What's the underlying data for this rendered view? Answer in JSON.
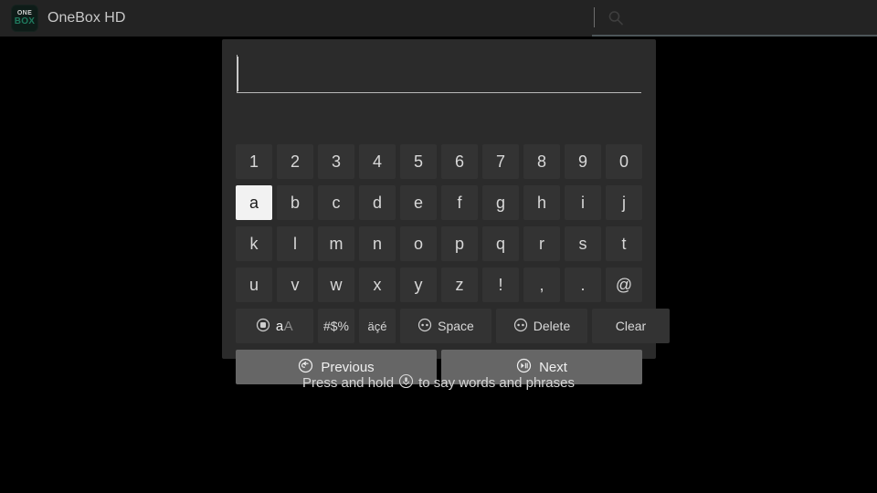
{
  "app": {
    "title": "OneBox HD",
    "logo_line1": "ONE",
    "logo_line2": "BOX"
  },
  "search": {
    "value": "",
    "placeholder": "",
    "icon": "search-icon"
  },
  "keyboard": {
    "input_value": "",
    "input_placeholder": "",
    "rows": [
      {
        "name": "number-row",
        "keys": [
          "1",
          "2",
          "3",
          "4",
          "5",
          "6",
          "7",
          "8",
          "9",
          "0"
        ]
      },
      {
        "name": "letter-row-1",
        "keys": [
          "a",
          "b",
          "c",
          "d",
          "e",
          "f",
          "g",
          "h",
          "i",
          "j"
        ],
        "focused": "a"
      },
      {
        "name": "letter-row-2",
        "keys": [
          "k",
          "l",
          "m",
          "n",
          "o",
          "p",
          "q",
          "r",
          "s",
          "t"
        ]
      },
      {
        "name": "letter-row-3",
        "keys": [
          "u",
          "v",
          "w",
          "x",
          "y",
          "z",
          "!",
          ",",
          ".",
          "@"
        ]
      }
    ],
    "function_keys": [
      {
        "name": "shift-key",
        "icon": "dpad-center-icon",
        "lower_label": "a",
        "upper_label": "A",
        "active_case": "lower"
      },
      {
        "name": "symbols-key",
        "label": "#$%"
      },
      {
        "name": "accents-key",
        "label": "äçé"
      },
      {
        "name": "space-key",
        "label": "Space",
        "icon": "dpad-horizontal-icon"
      },
      {
        "name": "delete-key",
        "label": "Delete",
        "icon": "dpad-horizontal-icon"
      },
      {
        "name": "clear-key",
        "label": "Clear"
      }
    ],
    "nav_buttons": [
      {
        "name": "previous-button",
        "label": "Previous",
        "icon": "back-circle-icon"
      },
      {
        "name": "next-button",
        "label": "Next",
        "icon": "play-pause-circle-icon"
      }
    ]
  },
  "voice_hint": {
    "prefix": "Press and hold",
    "icon": "microphone-icon",
    "suffix": "to say words and phrases"
  },
  "colors": {
    "background": "#000000",
    "topbar": "#232323",
    "dialog": "#2b2b2b",
    "key": "#333333",
    "key_focused": "#f2f2f2",
    "nav_button": "#666666",
    "text": "#d8d8d8",
    "logo_accent": "#1f7a5e"
  }
}
